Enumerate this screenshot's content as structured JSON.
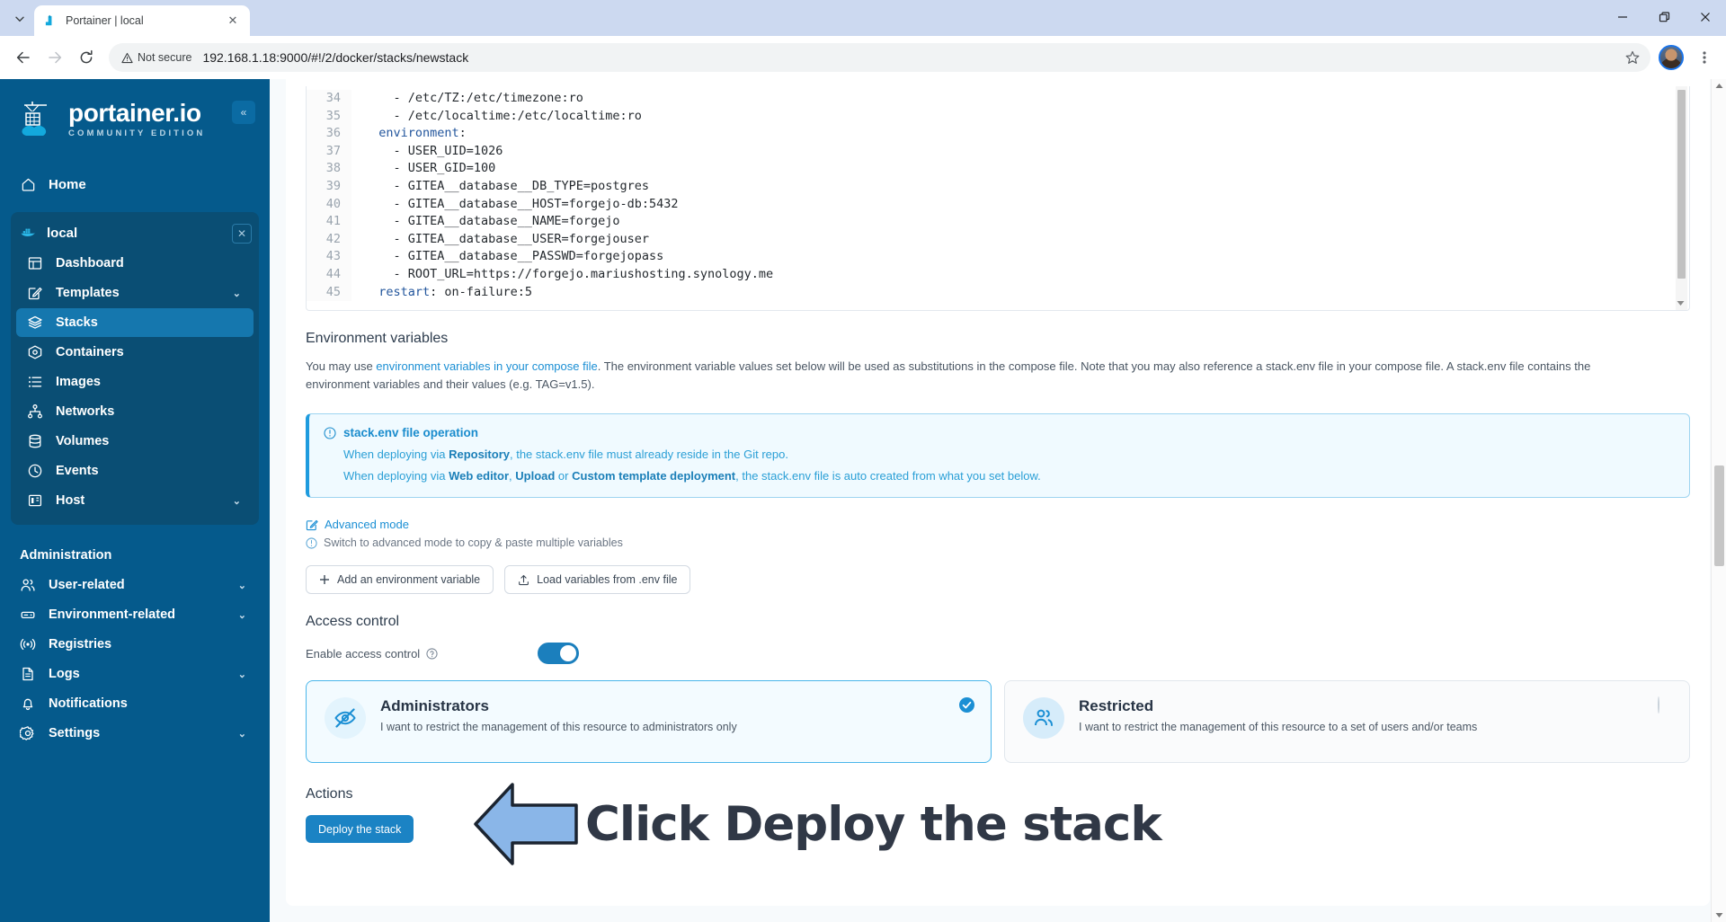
{
  "browser": {
    "tab_title": "Portainer | local",
    "tab_favicon": "portainer-icon",
    "close_tab_label": "✕",
    "tab_list_label": "⌄",
    "back_label": "←",
    "forward_label": "→",
    "reload_label": "↻",
    "security_label": "Not secure",
    "url": "192.168.1.18:9000/#!/2/docker/stacks/newstack",
    "bookmark_label": "☆",
    "menu_label": "⋮",
    "minimize_label": "—",
    "maximize_label": "❐",
    "close_label": "✕"
  },
  "sidebar": {
    "brand_name": "portainer.io",
    "brand_sub": "COMMUNITY EDITION",
    "collapse_label": "«",
    "home_label": "Home",
    "environment": {
      "name": "local",
      "close_label": "✕"
    },
    "env_items": [
      {
        "label": "Dashboard",
        "icon": "dashboard-icon",
        "chevron": "",
        "active": false
      },
      {
        "label": "Templates",
        "icon": "template-icon",
        "chevron": "⌄",
        "active": false
      },
      {
        "label": "Stacks",
        "icon": "stacks-icon",
        "chevron": "",
        "active": true
      },
      {
        "label": "Containers",
        "icon": "container-icon",
        "chevron": "",
        "active": false
      },
      {
        "label": "Images",
        "icon": "images-icon",
        "chevron": "",
        "active": false
      },
      {
        "label": "Networks",
        "icon": "networks-icon",
        "chevron": "",
        "active": false
      },
      {
        "label": "Volumes",
        "icon": "volumes-icon",
        "chevron": "",
        "active": false
      },
      {
        "label": "Events",
        "icon": "events-icon",
        "chevron": "",
        "active": false
      },
      {
        "label": "Host",
        "icon": "host-icon",
        "chevron": "⌄",
        "active": false
      }
    ],
    "admin_label": "Administration",
    "admin_items": [
      {
        "label": "User-related",
        "icon": "users-icon",
        "chevron": "⌄"
      },
      {
        "label": "Environment-related",
        "icon": "environment-icon",
        "chevron": "⌄"
      },
      {
        "label": "Registries",
        "icon": "registry-icon",
        "chevron": ""
      },
      {
        "label": "Logs",
        "icon": "logs-icon",
        "chevron": "⌄"
      },
      {
        "label": "Notifications",
        "icon": "bell-icon",
        "chevron": ""
      },
      {
        "label": "Settings",
        "icon": "gear-icon",
        "chevron": "⌄"
      }
    ]
  },
  "editor": {
    "first_line_number": 34,
    "lines": [
      {
        "n": 34,
        "text": "    - /etc/TZ:/etc/timezone:ro"
      },
      {
        "n": 35,
        "text": "    - /etc/localtime:/etc/localtime:ro"
      },
      {
        "n": 36,
        "text": "  environment:",
        "kw": "environment"
      },
      {
        "n": 37,
        "text": "    - USER_UID=1026"
      },
      {
        "n": 38,
        "text": "    - USER_GID=100"
      },
      {
        "n": 39,
        "text": "    - GITEA__database__DB_TYPE=postgres"
      },
      {
        "n": 40,
        "text": "    - GITEA__database__HOST=forgejo-db:5432"
      },
      {
        "n": 41,
        "text": "    - GITEA__database__NAME=forgejo"
      },
      {
        "n": 42,
        "text": "    - GITEA__database__USER=forgejouser"
      },
      {
        "n": 43,
        "text": "    - GITEA__database__PASSWD=forgejopass"
      },
      {
        "n": 44,
        "text": "    - ROOT_URL=https://forgejo.mariushosting.synology.me"
      },
      {
        "n": 45,
        "text": "  restart: on-failure:5",
        "kw": "restart"
      }
    ],
    "scroll_down_label": "▾"
  },
  "env_section": {
    "title": "Environment variables",
    "para_prefix": "You may use ",
    "para_link": "environment variables in your compose file",
    "para_suffix": ". The environment variable values set below will be used as substitutions in the compose file. Note that you may also reference a stack.env file in your compose file. A stack.env file contains the environment variables and their values (e.g. TAG=v1.5).",
    "infobox": {
      "icon": "info-icon",
      "title": "stack.env file operation",
      "line1_a": "When deploying via ",
      "line1_b": "Repository",
      "line1_c": ", the stack.env file must already reside in the Git repo.",
      "line2_a": "When deploying via ",
      "line2_b": "Web editor",
      "line2_c": ", ",
      "line2_d": "Upload",
      "line2_e": " or ",
      "line2_f": "Custom template deployment",
      "line2_g": ", the stack.env file is auto created from what you set below."
    },
    "advanced_mode_label": "Advanced mode",
    "advanced_mode_icon": "edit-icon",
    "advanced_hint": "Switch to advanced mode to copy & paste multiple variables",
    "advanced_hint_icon": "info-icon",
    "add_var_button": "Add an environment variable",
    "add_var_icon": "plus-icon",
    "load_env_button": "Load variables from .env file",
    "load_env_icon": "upload-icon"
  },
  "access_control": {
    "title": "Access control",
    "toggle_label": "Enable access control",
    "toggle_help_icon": "question-icon",
    "toggle_on": true,
    "cards": [
      {
        "title": "Administrators",
        "desc": "I want to restrict the management of this resource to administrators only",
        "icon": "eye-off-icon",
        "selected": true,
        "check_icon": "check-circle-icon"
      },
      {
        "title": "Restricted",
        "desc": "I want to restrict the management of this resource to a set of users and/or teams",
        "icon": "users-group-icon",
        "selected": false,
        "check_icon": "radio-empty-icon"
      }
    ]
  },
  "actions": {
    "title": "Actions",
    "deploy_button": "Deploy the stack"
  },
  "annotation": {
    "arrow_icon": "left-arrow-annotation",
    "text": "Click Deploy the stack",
    "arrow_fill": "#8ab6e8",
    "arrow_stroke": "#1b2430",
    "text_color": "#303846"
  },
  "theme": {
    "sidebar_bg": "#055a8c",
    "accent": "#1b83c4",
    "link": "#1b8fd4",
    "info_bg": "#f0faff",
    "info_border": "#9ed4f0"
  }
}
